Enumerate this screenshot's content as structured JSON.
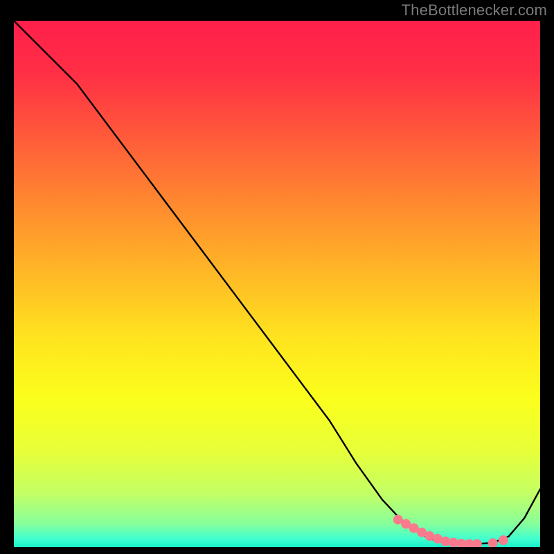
{
  "watermark": "TheBottlenecker.com",
  "gradient": {
    "stops": [
      {
        "offset": 0.0,
        "color": "#ff1f4b"
      },
      {
        "offset": 0.1,
        "color": "#ff2f45"
      },
      {
        "offset": 0.22,
        "color": "#ff5a3a"
      },
      {
        "offset": 0.35,
        "color": "#ff8a2f"
      },
      {
        "offset": 0.48,
        "color": "#ffb826"
      },
      {
        "offset": 0.6,
        "color": "#ffe31f"
      },
      {
        "offset": 0.72,
        "color": "#fbff1c"
      },
      {
        "offset": 0.82,
        "color": "#e6ff3a"
      },
      {
        "offset": 0.9,
        "color": "#c2ff66"
      },
      {
        "offset": 0.955,
        "color": "#88ff9a"
      },
      {
        "offset": 0.985,
        "color": "#3fffd0"
      },
      {
        "offset": 1.0,
        "color": "#18f0c8"
      }
    ]
  },
  "chart_data": {
    "type": "line",
    "title": "",
    "xlabel": "",
    "ylabel": "",
    "xlim": [
      0,
      100
    ],
    "ylim": [
      0,
      100
    ],
    "series": [
      {
        "name": "curve",
        "x": [
          0,
          6,
          12,
          18,
          24,
          30,
          36,
          42,
          48,
          54,
          60,
          65,
          70,
          74.5,
          79,
          82,
          85,
          88,
          91,
          94,
          97,
          100
        ],
        "y": [
          100,
          94,
          88,
          80,
          72,
          64,
          56,
          48,
          40,
          32,
          24,
          16,
          9,
          4.2,
          1.6,
          0.8,
          0.6,
          0.6,
          0.8,
          2.0,
          5.5,
          11
        ]
      }
    ],
    "markers": {
      "name": "pink-dots",
      "color": "#f97a8d",
      "radius": 7,
      "x": [
        73,
        74.5,
        76,
        77.5,
        79,
        80.5,
        82,
        83.5,
        85,
        86.5,
        88,
        91,
        93
      ],
      "y": [
        5.2,
        4.4,
        3.6,
        2.8,
        2.1,
        1.6,
        1.1,
        0.85,
        0.65,
        0.6,
        0.6,
        0.75,
        1.3
      ]
    }
  }
}
